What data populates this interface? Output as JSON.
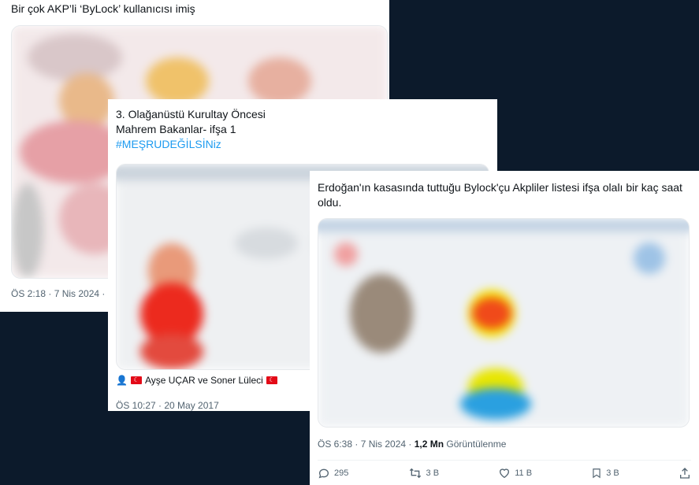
{
  "tweets": [
    {
      "text": "Bir çok AKP’li ‘ByLock’ kullanıcısı imiş",
      "timestamp": "ÖS 2:18 · 7 Nis 2024 ·"
    },
    {
      "text_line1": "3. Olağanüstü Kurultay Öncesi",
      "text_line2": "Mahrem Bakanlar- ifşa 1",
      "hashtag": "#MEŞRUDEĞİLSİNiz",
      "authors": "Ayşe UÇAR ve Soner Lüleci",
      "timestamp": "ÖS 10:27 · 20 May 2017"
    },
    {
      "text": "Erdoğan'ın kasasında tuttuğu Bylock'çu Akpliler listesi ifşa olalı bir kaç saat oldu.",
      "timestamp": "ÖS 6:38 · 7 Nis 2024 ·",
      "views_count": "1,2 Mn",
      "views_label": "Görüntülenme",
      "replies": "295",
      "reposts": "3 B",
      "likes": "11 B",
      "bookmarks": "3 B"
    }
  ],
  "colors": {
    "background": "#0c1a2b",
    "accent": "#1d9bf0",
    "flag": "#e30a17"
  }
}
